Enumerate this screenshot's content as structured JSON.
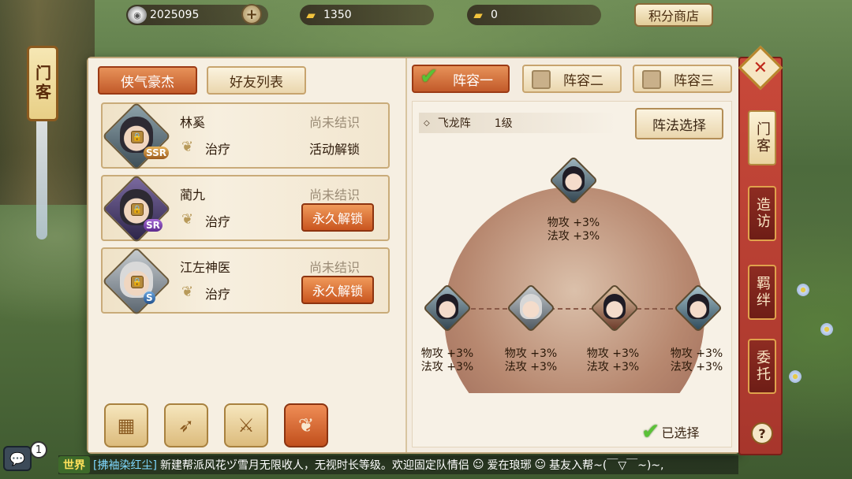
{
  "resources": {
    "coins": "2025095",
    "ingots": "1350",
    "gold": "0",
    "shop_label": "积分商店"
  },
  "hanging_tag": "门客",
  "left_tabs": [
    {
      "label": "侠气豪杰",
      "active": true
    },
    {
      "label": "好友列表",
      "active": false
    }
  ],
  "heroes": [
    {
      "name": "林奚",
      "rarity": "SSR",
      "role": "治疗",
      "status": "尚未结识",
      "unlock": "活动解锁",
      "unlock_is_button": false
    },
    {
      "name": "蔺九",
      "rarity": "SR",
      "role": "治疗",
      "status": "尚未结识",
      "unlock": "永久解锁",
      "unlock_is_button": true
    },
    {
      "name": "江左神医",
      "rarity": "S",
      "role": "治疗",
      "status": "尚未结识",
      "unlock": "永久解锁",
      "unlock_is_button": true
    }
  ],
  "filter_icons": [
    "grid-icon",
    "bow-icon",
    "crossed-swords-icon",
    "leaf-icon"
  ],
  "lineup_tabs": [
    {
      "label": "阵容一",
      "active": true
    },
    {
      "label": "阵容二",
      "active": false
    },
    {
      "label": "阵容三",
      "active": false
    }
  ],
  "formation": {
    "name": "飞龙阵",
    "level": "1级",
    "select_label": "阵法选择",
    "top_bonus": [
      "物攻 +3%",
      "法攻 +3%"
    ],
    "bottom_bonuses": [
      [
        "物攻 +3%",
        "法攻 +3%"
      ],
      [
        "物攻 +3%",
        "法攻 +3%"
      ],
      [
        "物攻 +3%",
        "法攻 +3%"
      ],
      [
        "物攻 +3%",
        "法攻 +3%"
      ]
    ],
    "selected_label": "已选择"
  },
  "side_tabs": [
    {
      "label": "门客",
      "active": true
    },
    {
      "label": "造访",
      "active": false
    },
    {
      "label": "羁绊",
      "active": false
    },
    {
      "label": "委托",
      "active": false
    }
  ],
  "chat": {
    "badge": "1",
    "channel": "世界",
    "user": "[拂袖染红尘]",
    "message": "新建帮派风花ヅ雪月无限收人，无视时长等级。欢迎固定队情侣",
    "message2": "爱在琅琊",
    "message3": "基友入帮~(￣▽￣~)~,"
  },
  "colors": {
    "accent_orange": "#c25a2a",
    "panel_bg": "#f3ebdc",
    "rail_red": "#a7362c",
    "check_green": "#5ac236"
  }
}
